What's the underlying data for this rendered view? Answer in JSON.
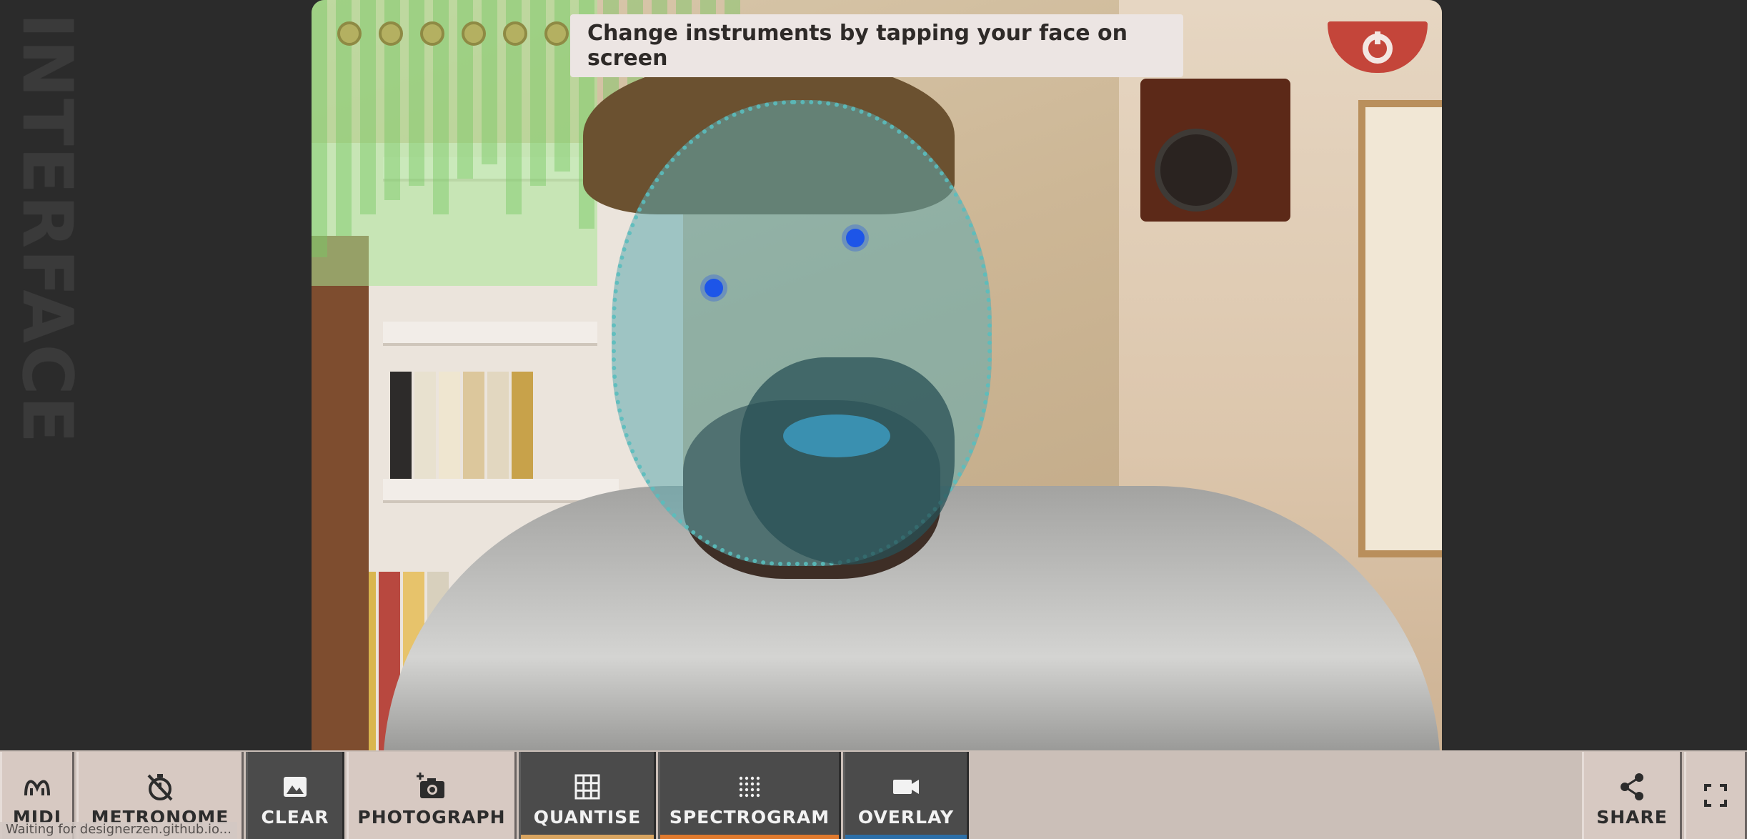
{
  "brand": {
    "word": "INTERFACE"
  },
  "hint": {
    "text": "Change instruments by tapping your face on screen"
  },
  "toolbar": {
    "midi": {
      "label": "MIDI",
      "icon": "midi-icon"
    },
    "metronome": {
      "label": "METRONOME",
      "icon": "metronome-off-icon"
    },
    "clear": {
      "label": "CLEAR",
      "icon": "image-icon",
      "state": "dark"
    },
    "photograph": {
      "label": "PHOTOGRAPH",
      "icon": "add-camera-icon"
    },
    "quantise": {
      "label": "QUANTISE",
      "icon": "grid-icon",
      "state": "dark",
      "accent": "#d8a460"
    },
    "spectrogram": {
      "label": "SPECTROGRAM",
      "icon": "dots-grid-icon",
      "state": "dark",
      "accent": "#e07a2e"
    },
    "overlay": {
      "label": "OVERLAY",
      "icon": "video-camera-icon",
      "state": "dark",
      "accent": "#2c6fa8"
    },
    "share": {
      "label": "SHARE",
      "icon": "share-icon"
    },
    "fullscreen": {
      "icon": "fullscreen-icon"
    }
  },
  "status": {
    "text": "Waiting for designerzen.github.io..."
  },
  "colors": {
    "logo": "#c4453a",
    "toolbar_bg": "#cbbfb8",
    "dark_button": "#4b4b4b"
  }
}
